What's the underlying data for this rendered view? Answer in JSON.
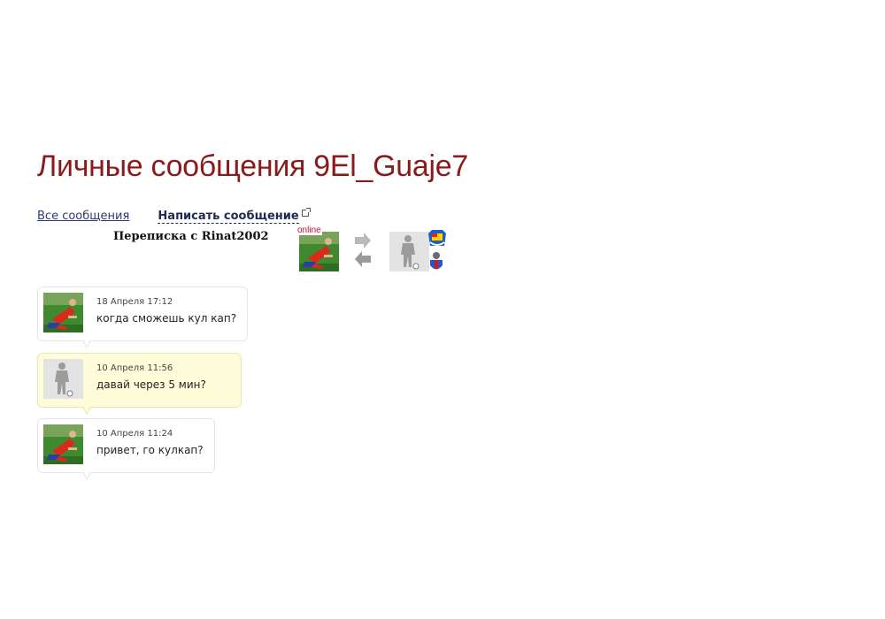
{
  "page": {
    "title": "Личные сообщения 9El_Guaje7"
  },
  "nav": {
    "all_messages": "Все сообщения",
    "write_message": "Написать сообщение"
  },
  "conversation": {
    "title": "Переписка с Rinat2002",
    "online_label": "online",
    "icons": [
      "player-avatar-icon",
      "arrow-right-icon",
      "arrow-left-icon",
      "silhouette-avatar-icon",
      "club-crest-icon",
      "club-badge-icon"
    ]
  },
  "messages": [
    {
      "time": "18 Апреля 17:12",
      "text": "когда сможешь кул кап?",
      "incoming": false,
      "avatar": "player-avatar-icon"
    },
    {
      "time": "10 Апреля 11:56",
      "text": "давай через 5 мин?",
      "incoming": true,
      "avatar": "silhouette-avatar-icon"
    },
    {
      "time": "10 Апреля 11:24",
      "text": "привет, го кулкап?",
      "incoming": false,
      "avatar": "player-avatar-icon"
    }
  ],
  "colors": {
    "title": "#8b1a1a",
    "link": "#2d3a6e",
    "incoming_bg": "#fefcd9",
    "online": "#c8102e"
  }
}
